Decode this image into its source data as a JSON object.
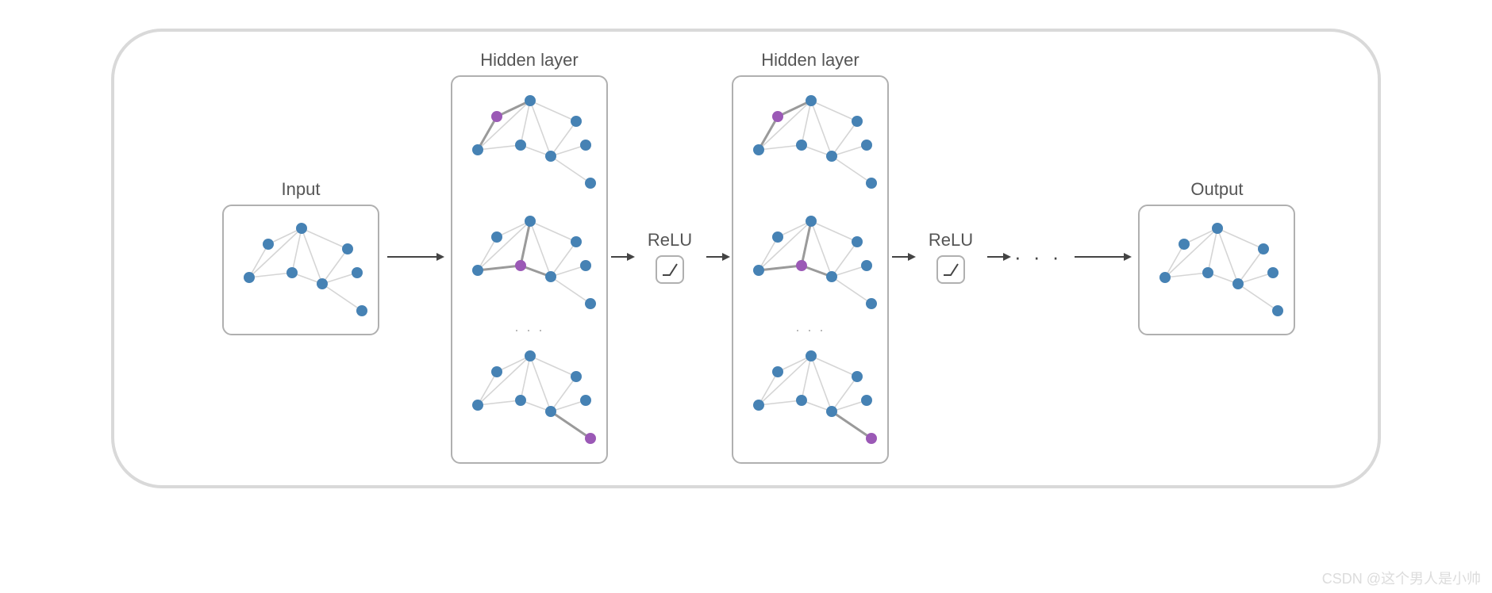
{
  "labels": {
    "input": "Input",
    "hidden1": "Hidden layer",
    "hidden2": "Hidden layer",
    "output": "Output",
    "activation": "ReLU",
    "dots_v": "· · ·",
    "dots_h": "· · ·"
  },
  "colors": {
    "node": "#4682b4",
    "highlight": "#9b59b6",
    "edge_light": "#d5d5d5",
    "edge_heavy": "#9a9a9a",
    "border": "#b0b0b0",
    "text": "#555555"
  },
  "chart_data": {
    "type": "diagram",
    "description": "Graph Neural Network architecture diagram",
    "stages": [
      {
        "name": "Input",
        "panels": 1,
        "activation_after": false
      },
      {
        "name": "Hidden layer",
        "panels": 3,
        "more_panels": true,
        "activation_after": true,
        "activation": "ReLU"
      },
      {
        "name": "Hidden layer",
        "panels": 3,
        "more_panels": true,
        "activation_after": true,
        "activation": "ReLU"
      },
      {
        "name": "ellipsis",
        "panels": 0
      },
      {
        "name": "Output",
        "panels": 1,
        "activation_after": false
      }
    ],
    "graph_topology": {
      "nodes": [
        0,
        1,
        2,
        3,
        4,
        5,
        6,
        7
      ],
      "edges": [
        [
          0,
          1
        ],
        [
          1,
          2
        ],
        [
          0,
          3
        ],
        [
          3,
          1
        ],
        [
          3,
          4
        ],
        [
          4,
          1
        ],
        [
          4,
          5
        ],
        [
          1,
          5
        ],
        [
          5,
          2
        ],
        [
          5,
          6
        ],
        [
          5,
          7
        ]
      ],
      "highlighted_center_indices_per_hidden_panel": [
        0,
        4,
        7
      ]
    }
  },
  "watermark": "CSDN @这个男人是小帅"
}
